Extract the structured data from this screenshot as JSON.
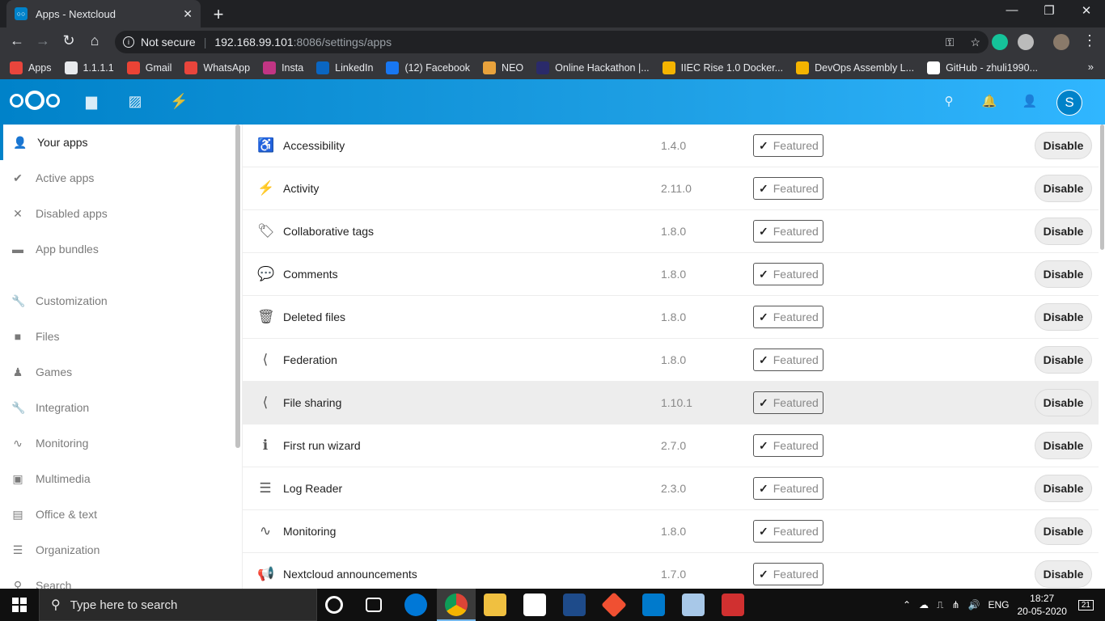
{
  "browser": {
    "tab_title": "Apps - Nextcloud",
    "tab_close": "✕",
    "new_tab": "+",
    "window_controls": [
      "—",
      "❐",
      "✕"
    ],
    "security_label": "Not secure",
    "url_host": "192.168.99.101",
    "url_path": ":8086/settings/apps",
    "bookmarks": [
      {
        "label": "Apps",
        "color": "#e8453c"
      },
      {
        "label": "1.1.1.1",
        "color": "#e8eaed"
      },
      {
        "label": "Gmail",
        "color": "#ea4335"
      },
      {
        "label": "WhatsApp",
        "color": "#e8453c"
      },
      {
        "label": "Insta",
        "color": "#c13584"
      },
      {
        "label": "LinkedIn",
        "color": "#0a66c2"
      },
      {
        "label": "(12) Facebook",
        "color": "#1877f2"
      },
      {
        "label": "NEO",
        "color": "#e8a23c"
      },
      {
        "label": "Online Hackathon |...",
        "color": "#2a2a6a"
      },
      {
        "label": "IIEC Rise 1.0 Docker...",
        "color": "#f4b400"
      },
      {
        "label": "DevOps Assembly L...",
        "color": "#f4b400"
      },
      {
        "label": "GitHub - zhuli1990...",
        "color": "#ffffff"
      }
    ],
    "bookmarks_more": "»"
  },
  "nextcloud": {
    "avatar_letter": "S",
    "sidebar": [
      {
        "label": "Your apps",
        "icon": "👤",
        "active": true
      },
      {
        "label": "Active apps",
        "icon": "✔"
      },
      {
        "label": "Disabled apps",
        "icon": "✕"
      },
      {
        "label": "App bundles",
        "icon": "▬"
      },
      {
        "label": "Customization",
        "icon": "🔧"
      },
      {
        "label": "Files",
        "icon": "■"
      },
      {
        "label": "Games",
        "icon": "♟"
      },
      {
        "label": "Integration",
        "icon": "🔧"
      },
      {
        "label": "Monitoring",
        "icon": "∿"
      },
      {
        "label": "Multimedia",
        "icon": "▣"
      },
      {
        "label": "Office & text",
        "icon": "▤"
      },
      {
        "label": "Organization",
        "icon": "☰"
      },
      {
        "label": "Search",
        "icon": "⚲"
      }
    ],
    "featured_label": "Featured",
    "disable_label": "Disable",
    "apps": [
      {
        "name": "Accessibility",
        "version": "1.4.0",
        "icon": "♿"
      },
      {
        "name": "Activity",
        "version": "2.11.0",
        "icon": "⚡"
      },
      {
        "name": "Collaborative tags",
        "version": "1.8.0",
        "icon": "🏷"
      },
      {
        "name": "Comments",
        "version": "1.8.0",
        "icon": "💬"
      },
      {
        "name": "Deleted files",
        "version": "1.8.0",
        "icon": "🗑"
      },
      {
        "name": "Federation",
        "version": "1.8.0",
        "icon": "⟨"
      },
      {
        "name": "File sharing",
        "version": "1.10.1",
        "icon": "⟨",
        "hover": true
      },
      {
        "name": "First run wizard",
        "version": "2.7.0",
        "icon": "ℹ"
      },
      {
        "name": "Log Reader",
        "version": "2.3.0",
        "icon": "☰"
      },
      {
        "name": "Monitoring",
        "version": "1.8.0",
        "icon": "∿"
      },
      {
        "name": "Nextcloud announcements",
        "version": "1.7.0",
        "icon": "📢"
      }
    ]
  },
  "taskbar": {
    "search_placeholder": "Type here to search",
    "language": "ENG",
    "time": "18:27",
    "date": "20-05-2020",
    "notification_count": "21"
  }
}
